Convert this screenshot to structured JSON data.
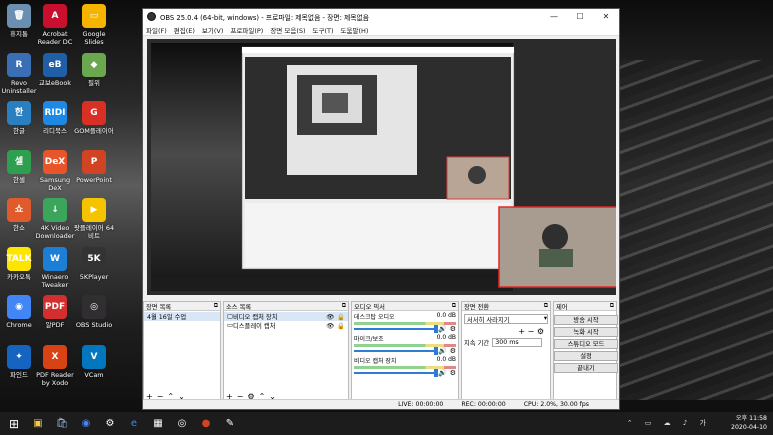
{
  "desktop": {
    "icons": [
      {
        "label": "휴지통",
        "color": "#6b8fb0",
        "glyph": "🗑"
      },
      {
        "label": "Acrobat\nReader DC",
        "color": "#c8102e",
        "glyph": "A"
      },
      {
        "label": "Google\nSlides",
        "color": "#f4b400",
        "glyph": "▭"
      },
      {
        "label": "Revo\nUninstaller",
        "color": "#3a6fb5",
        "glyph": "R"
      },
      {
        "label": "교보eBook",
        "color": "#1f5fa8",
        "glyph": "eB"
      },
      {
        "label": "필위",
        "color": "#6aa84f",
        "glyph": "◆"
      },
      {
        "label": "한글",
        "color": "#2a7fc1",
        "glyph": "한"
      },
      {
        "label": "리디북스",
        "color": "#1e88e5",
        "glyph": "RIDI"
      },
      {
        "label": "GOM플레이어",
        "color": "#d93025",
        "glyph": "G"
      },
      {
        "label": "한셀",
        "color": "#2e9e4f",
        "glyph": "셀"
      },
      {
        "label": "Samsung\nDeX",
        "color": "#e8552b",
        "glyph": "DeX"
      },
      {
        "label": "PowerPoint",
        "color": "#d04423",
        "glyph": "P"
      },
      {
        "label": "한쇼",
        "color": "#e05a2b",
        "glyph": "쇼"
      },
      {
        "label": "4K Video\nDownloader",
        "color": "#3ba55c",
        "glyph": "↓"
      },
      {
        "label": "팟플레이어 64\n비트",
        "color": "#f5c400",
        "glyph": "▶"
      },
      {
        "label": "카카오톡",
        "color": "#fee500",
        "glyph": "TALK"
      },
      {
        "label": "Winaero\nTweaker",
        "color": "#1b7fd6",
        "glyph": "W"
      },
      {
        "label": "5KPlayer",
        "color": "#333333",
        "glyph": "5K"
      },
      {
        "label": "Chrome",
        "color": "#4285f4",
        "glyph": "◉"
      },
      {
        "label": "알PDF",
        "color": "#d32f2f",
        "glyph": "PDF"
      },
      {
        "label": "OBS Studio",
        "color": "#302e31",
        "glyph": "◎"
      },
      {
        "label": "파인드",
        "color": "#1565c0",
        "glyph": "✦"
      },
      {
        "label": "PDF Reader\nby Xodo",
        "color": "#d84315",
        "glyph": "X"
      },
      {
        "label": "VCam",
        "color": "#0277bd",
        "glyph": "V"
      }
    ]
  },
  "obs": {
    "title": "OBS 25.0.4 (64-bit, windows) - 프로파일: 제목없음 - 장면: 제목없음",
    "menu": [
      "파일(F)",
      "편집(E)",
      "보기(V)",
      "프로파일(P)",
      "장면 모음(S)",
      "도구(T)",
      "도움말(H)"
    ],
    "scenes": {
      "title": "장면 목록",
      "items": [
        "4월 16일 수업"
      ]
    },
    "sources": {
      "title": "소스 목록",
      "items": [
        "비디오 캡처 장치",
        "디스플레이 캡처"
      ]
    },
    "mixer": {
      "title": "오디오 믹서",
      "tracks": [
        {
          "name": "데스크탑 오디오",
          "db": "0.0 dB"
        },
        {
          "name": "마이크/보조",
          "db": "0.0 dB"
        },
        {
          "name": "비디오 캡처 장치",
          "db": "0.0 dB"
        }
      ]
    },
    "transitions": {
      "title": "장면 전환",
      "type": "서서히 사라지기",
      "duration_label": "지속 기간",
      "duration": "300 ms"
    },
    "controls": {
      "title": "제어",
      "buttons": [
        "방송 시작",
        "녹화 시작",
        "스튜디오 모드",
        "설정",
        "끝내기"
      ]
    },
    "status": {
      "live": "LIVE: 00:00:00",
      "rec": "REC: 00:00:00",
      "cpu": "CPU: 2.0%, 30.00 fps"
    }
  },
  "tray": {
    "time": "오후 11:58",
    "date": "2020-04-10"
  }
}
